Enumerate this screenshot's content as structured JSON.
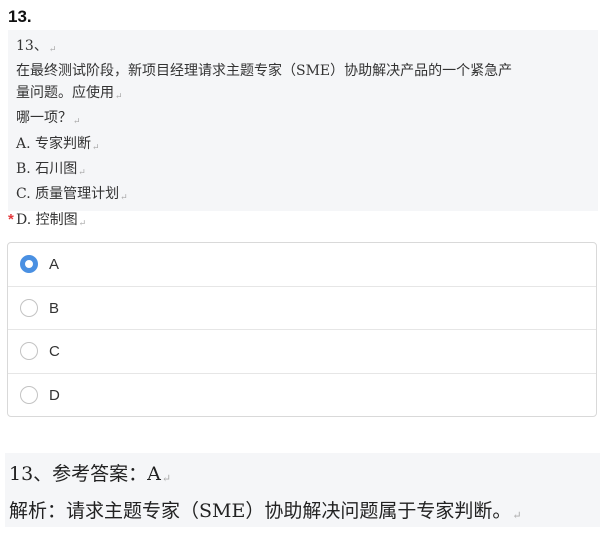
{
  "question": {
    "number": "13.",
    "stem_lines": [
      "13、",
      "在最终测试阶段，新项目经理请求主题专家（SME）协助解决产品的一个紧急产",
      "量问题。应使用",
      "哪一项？",
      "A.  专家判断",
      "B.  石川图",
      "C.  质量管理计划",
      "D.  控制图"
    ],
    "paragraph_mark": "↵",
    "required_mark": "*"
  },
  "options": [
    {
      "label": "A",
      "selected": true
    },
    {
      "label": "B",
      "selected": false
    },
    {
      "label": "C",
      "selected": false
    },
    {
      "label": "D",
      "selected": false
    }
  ],
  "answer": {
    "line1": "13、参考答案：A",
    "line2": "解析：请求主题专家（SME）协助解决问题属于专家判断。"
  },
  "colors": {
    "radio_selected": "#4a90e2",
    "required": "#e4393c"
  }
}
